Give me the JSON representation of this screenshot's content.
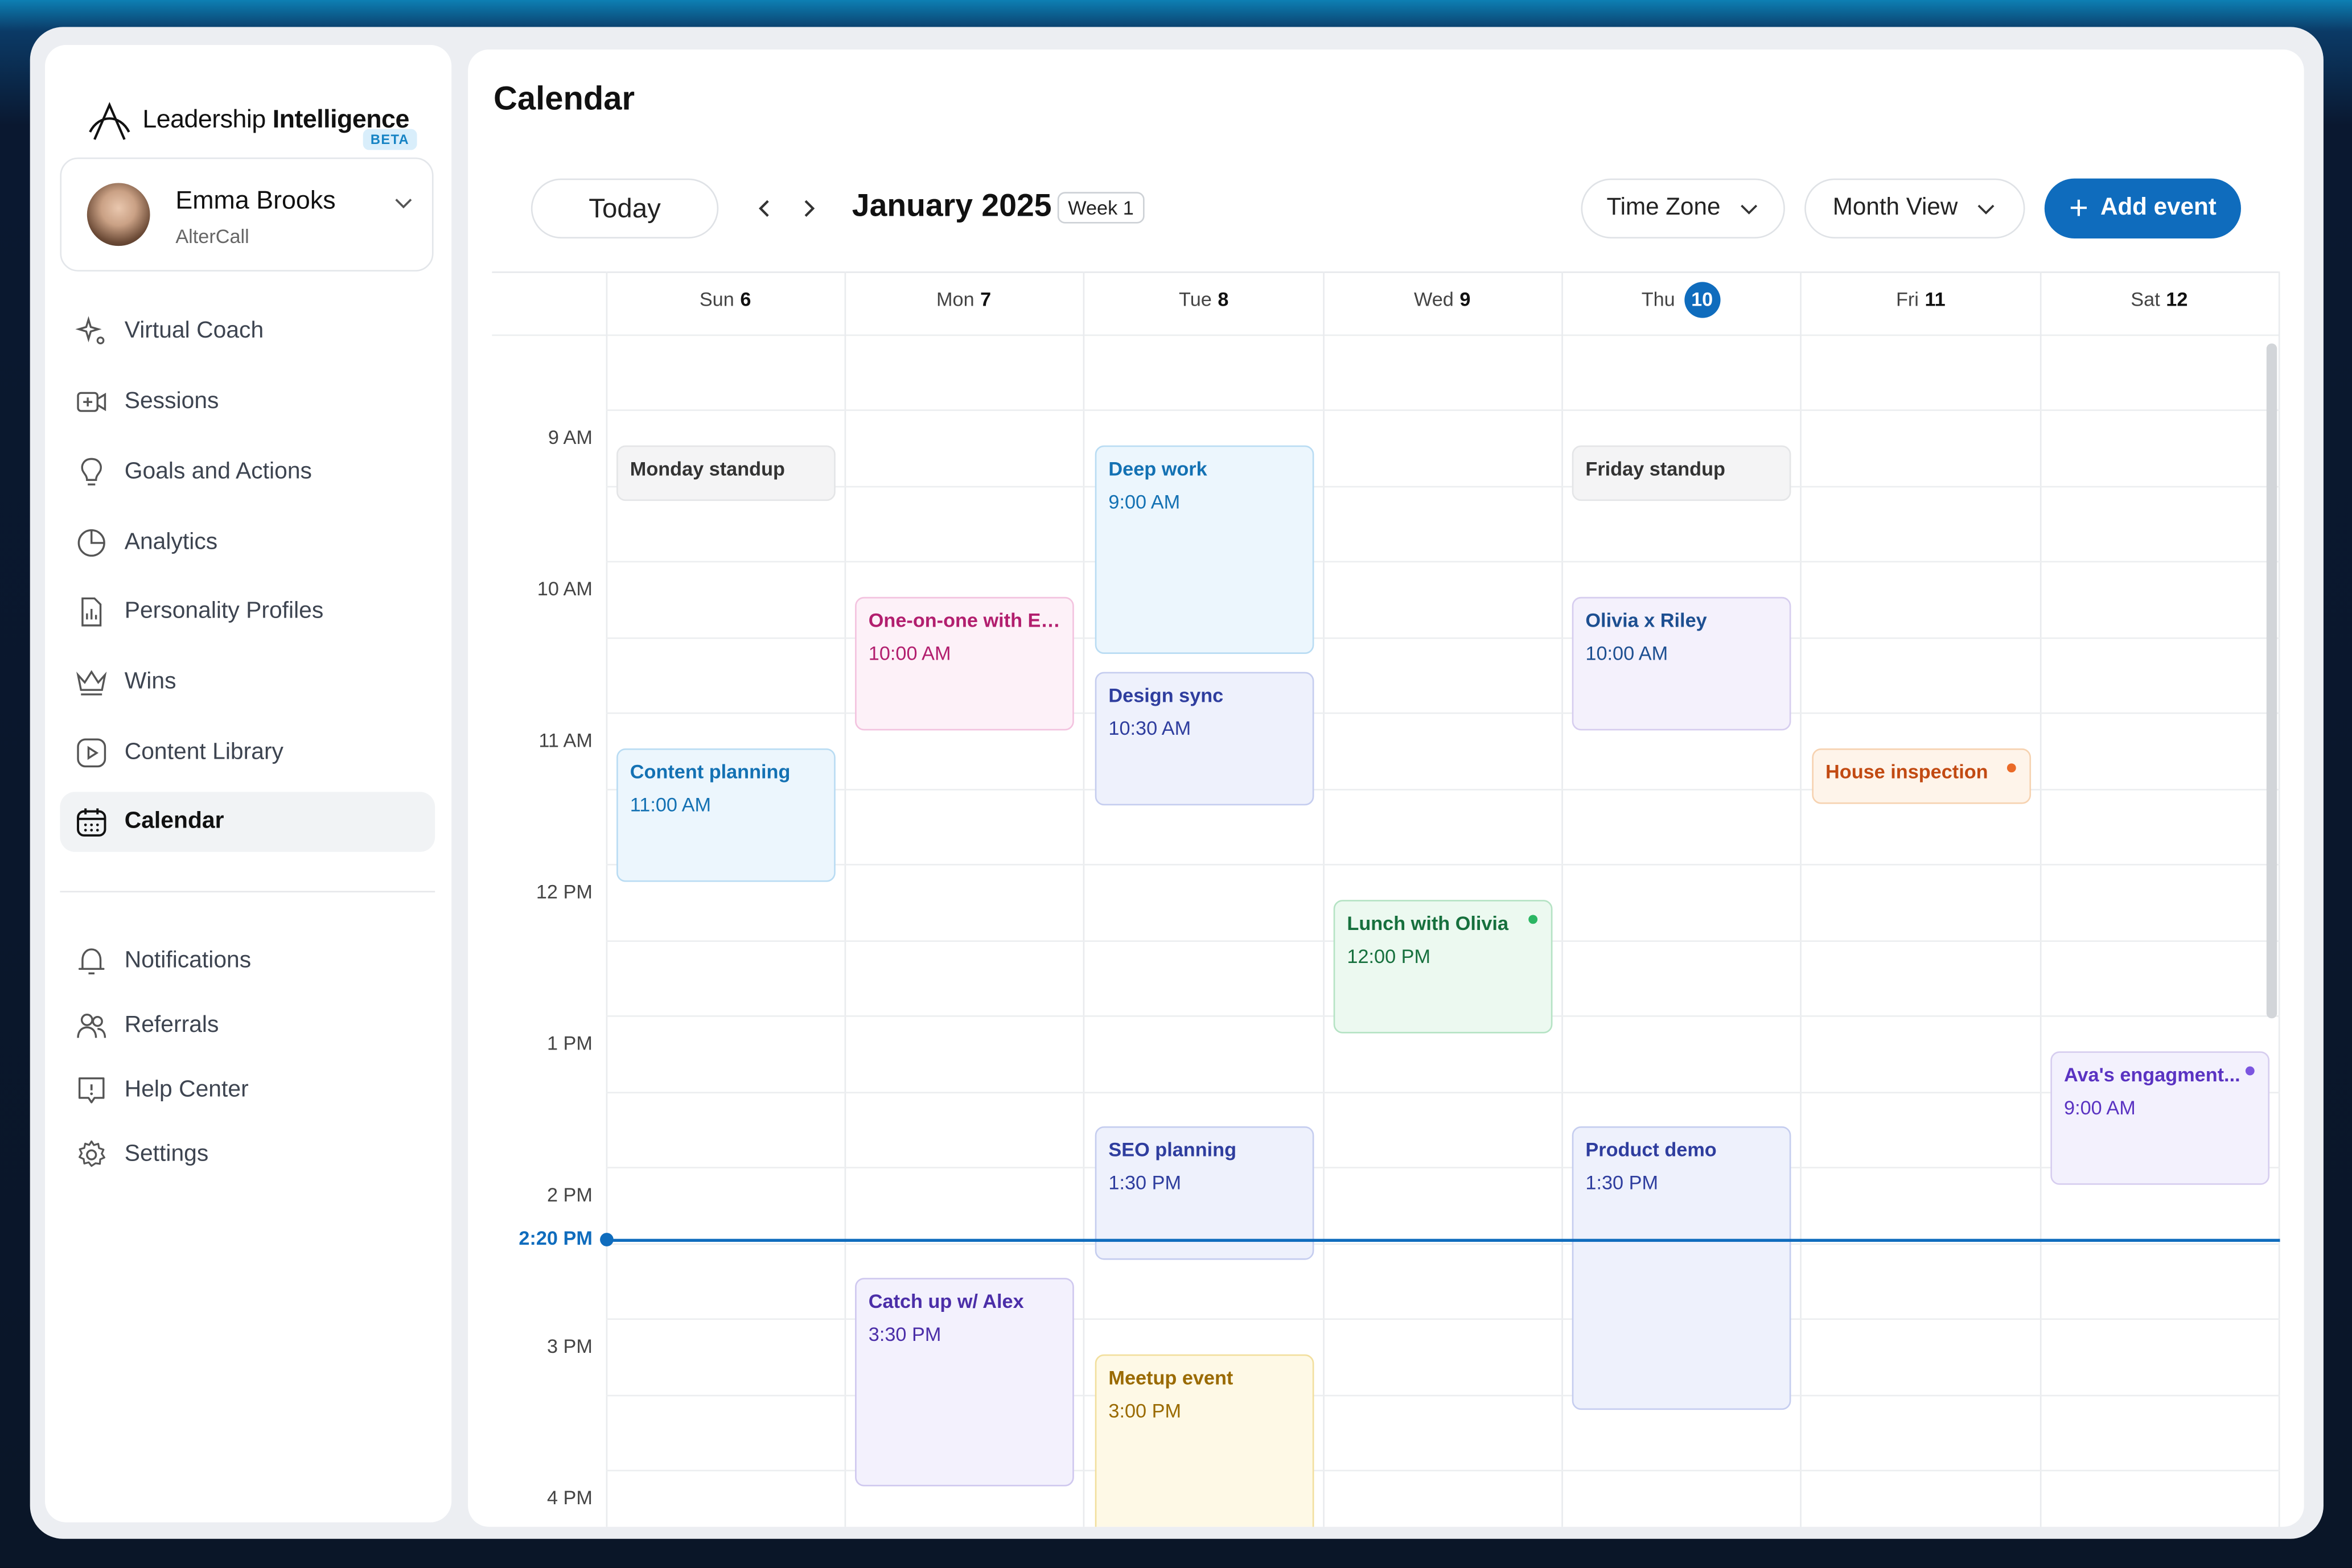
{
  "app": {
    "name_light": "Leadership",
    "name_bold": "Intelligence",
    "badge": "BETA"
  },
  "profile": {
    "name": "Emma Brooks",
    "org": "AlterCall"
  },
  "nav": [
    {
      "label": "Virtual Coach"
    },
    {
      "label": "Sessions"
    },
    {
      "label": "Goals and Actions"
    },
    {
      "label": "Analytics"
    },
    {
      "label": "Personality Profiles"
    },
    {
      "label": "Wins"
    },
    {
      "label": "Content Library"
    },
    {
      "label": "Calendar"
    }
  ],
  "nav_bottom": [
    {
      "label": "Notifications"
    },
    {
      "label": "Referrals"
    },
    {
      "label": "Help Center"
    },
    {
      "label": "Settings"
    }
  ],
  "page": {
    "title": "Calendar"
  },
  "toolbar": {
    "today": "Today",
    "month": "January 2025",
    "week": "Week 1",
    "timezone": "Time Zone",
    "view": "Month View",
    "add": "Add event"
  },
  "days": [
    {
      "dow": "Sun",
      "num": "6"
    },
    {
      "dow": "Mon",
      "num": "7"
    },
    {
      "dow": "Tue",
      "num": "8"
    },
    {
      "dow": "Wed",
      "num": "9"
    },
    {
      "dow": "Thu",
      "num": "10"
    },
    {
      "dow": "Fri",
      "num": "11"
    },
    {
      "dow": "Sat",
      "num": "12"
    }
  ],
  "hours": [
    "9 AM",
    "10 AM",
    "11 AM",
    "12 PM",
    "1 PM",
    "2 PM",
    "3 PM",
    "4 PM"
  ],
  "now": "2:20 PM",
  "colors": {
    "accent": "#0f6cbd"
  },
  "events": {
    "sun_standup": {
      "title": "Monday standup"
    },
    "sun_content": {
      "title": "Content planning",
      "time": "11:00 AM"
    },
    "mon_eva": {
      "title": "One-on-one with Eva",
      "time": "10:00 AM"
    },
    "mon_alex": {
      "title": "Catch up w/ Alex",
      "time": "3:30 PM"
    },
    "tue_deep": {
      "title": "Deep work",
      "time": "9:00 AM"
    },
    "tue_design": {
      "title": "Design sync",
      "time": "10:30 AM"
    },
    "tue_seo": {
      "title": "SEO planning",
      "time": "1:30 PM"
    },
    "tue_meetup": {
      "title": "Meetup event",
      "time": "3:00 PM"
    },
    "wed_lunch": {
      "title": "Lunch with Olivia",
      "time": "12:00 PM"
    },
    "thu_standup": {
      "title": "Friday standup"
    },
    "thu_olivia": {
      "title": "Olivia x Riley",
      "time": "10:00 AM"
    },
    "thu_demo": {
      "title": "Product demo",
      "time": "1:30 PM"
    },
    "fri_house": {
      "title": "House inspection"
    },
    "sat_ava": {
      "title": "Ava's engagment...",
      "time": "9:00 AM"
    }
  }
}
